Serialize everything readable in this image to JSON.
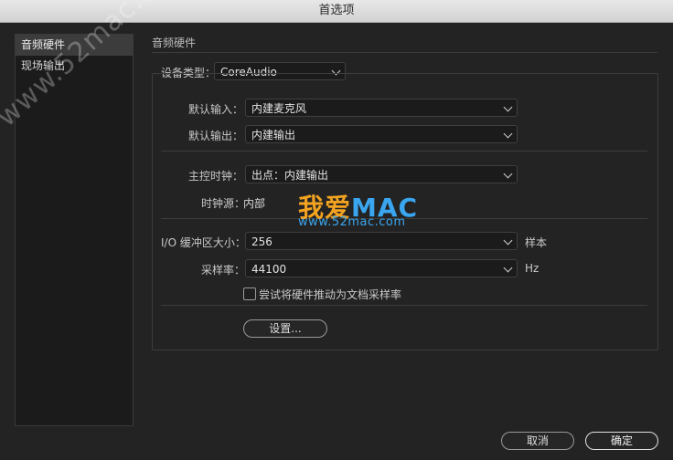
{
  "window": {
    "title": "首选项"
  },
  "sidebar": {
    "items": [
      {
        "label": "音频硬件"
      },
      {
        "label": "现场输出"
      }
    ]
  },
  "section": {
    "title": "音频硬件"
  },
  "form": {
    "device_type": {
      "label": "设备类型：",
      "value": "CoreAudio"
    },
    "default_input": {
      "label": "默认输入：",
      "value": "内建麦克风"
    },
    "default_output": {
      "label": "默认输出：",
      "value": "内建输出"
    },
    "master_clock": {
      "label": "主控时钟：",
      "value": "出点：内建输出"
    },
    "clock_source": {
      "label": "时钟源：",
      "value": "内部"
    },
    "buffer_size": {
      "label": "I/O 缓冲区大小：",
      "value": "256",
      "unit": "样本"
    },
    "sample_rate": {
      "label": "采样率：",
      "value": "44100",
      "unit": "Hz"
    },
    "try_hardware_rate": {
      "label": "尝试将硬件推动为文档采样率",
      "checked": false
    },
    "settings_button": "设置..."
  },
  "footer": {
    "cancel": "取消",
    "ok": "确定"
  },
  "watermark": {
    "diagonal": "www.52mac.com",
    "logo_part1": "我爱",
    "logo_part2": "MAC",
    "url": "www.52mac.com"
  },
  "colors": {
    "background": "#232323",
    "logo_orange": "#f3a320",
    "logo_blue": "#3aa6f0"
  }
}
